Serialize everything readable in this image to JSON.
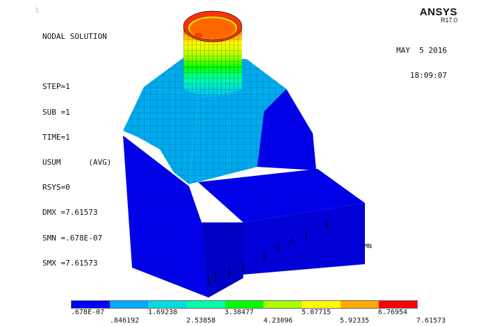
{
  "window_number": "1",
  "app": {
    "name": "ANSYS",
    "version": "R17.0"
  },
  "date": "MAY  5 2016",
  "time": "18:09:07",
  "info_lines": [
    "NODAL SOLUTION",
    "",
    "STEP=1",
    "SUB =1",
    "TIME=1",
    "USUM      (AVG)",
    "RSYS=0",
    "DMX =7.61573",
    "SMN =.678E-07",
    "SMX =7.61573"
  ],
  "markers": {
    "min": "MN",
    "max": "MX"
  },
  "legend": {
    "colors": [
      "#0000ff",
      "#00aaff",
      "#00dddd",
      "#00ffaa",
      "#00ff00",
      "#aaff00",
      "#ffff00",
      "#ffaa00",
      "#ff0000"
    ],
    "top_ticks": [
      ".678E-07",
      "1.69238",
      "3.38477",
      "5.07715",
      "6.76954"
    ],
    "bottom_ticks": [
      ".846192",
      "2.53858",
      "4.23096",
      "5.92335",
      "7.61573"
    ]
  }
}
